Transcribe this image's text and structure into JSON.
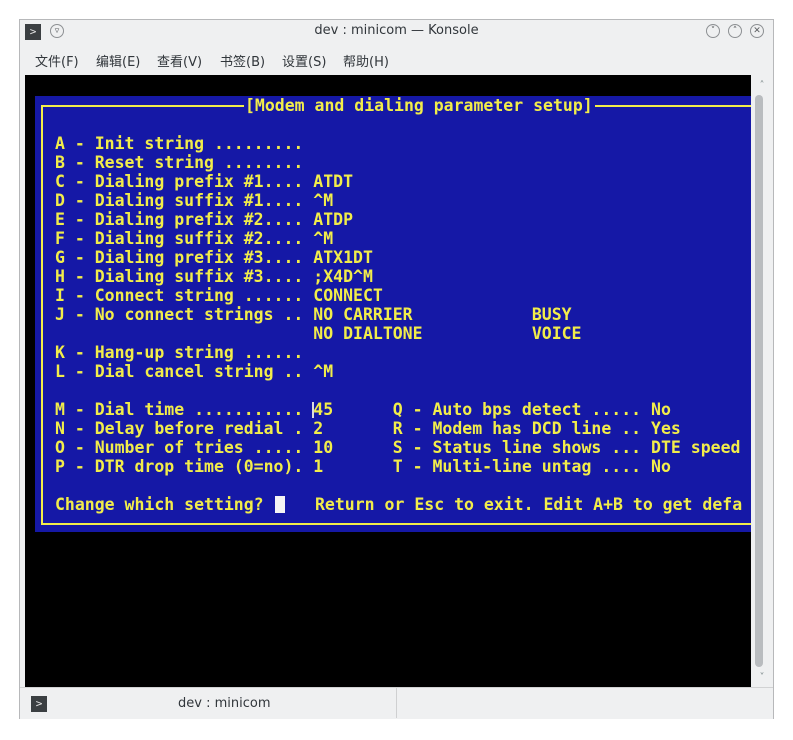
{
  "window": {
    "title": "dev : minicom — Konsole",
    "app_icon": ">",
    "tb_left_icon": "▿",
    "minimize_icon": "˅",
    "maximize_icon": "˄",
    "close_icon": "✕"
  },
  "menu": [
    "文件(F)",
    "编辑(E)",
    "查看(V)",
    "书签(B)",
    "设置(S)",
    "帮助(H)"
  ],
  "terminal": {
    "dialog_title": "[Modem and dialing parameter setup]",
    "lines": [
      "A - Init string .........",
      "B - Reset string ........",
      "C - Dialing prefix #1.... ATDT",
      "D - Dialing suffix #1.... ^M",
      "E - Dialing prefix #2.... ATDP",
      "F - Dialing suffix #2.... ^M",
      "G - Dialing prefix #3.... ATX1DT",
      "H - Dialing suffix #3.... ;X4D^M",
      "I - Connect string ...... CONNECT",
      "J - No connect strings .. NO CARRIER            BUSY",
      "                          NO DIALTONE           VOICE",
      "",
      "K - Hang-up string ......",
      "L - Dial cancel string .. ^M",
      "",
      "M - Dial time ........... 45      Q - Auto bps detect ..... No",
      "N - Delay before redial . 2       R - Modem has DCD line .. Yes",
      "O - Number of tries ..... 10      S - Status line shows ... DTE speed",
      "P - DTR drop time (0=no). 1       T - Multi-line untag .... No",
      "",
      "Change which setting?"
    ],
    "footer_hint": "Return or Esc to exit. Edit A+B to get defa"
  },
  "scrollbar": {
    "up_icon": "˄",
    "down_icon": "˅"
  },
  "tab": {
    "label": "dev : minicom",
    "icon": ">"
  },
  "colors": {
    "terminal_bg": "#000000",
    "dialog_bg": "#1518a6",
    "dialog_text": "#f2ed4a"
  }
}
